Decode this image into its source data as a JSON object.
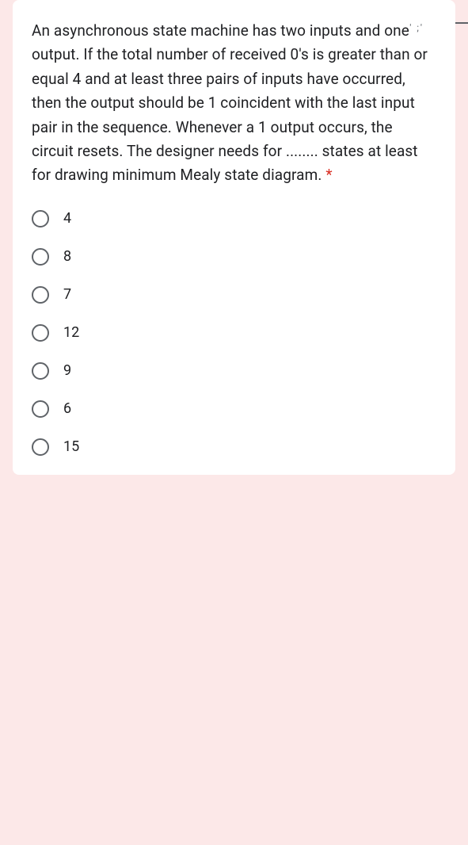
{
  "question": {
    "text": "An asynchronous state machine has two inputs and one output. If the total number of received 0's is greater than or equal 4 and at least three pairs of inputs have occurred, then the output should be 1 coincident with the last input pair in the sequence. Whenever a 1 output occurs, the circuit resets. The designer needs for ........ states at least for drawing minimum Mealy state diagram.",
    "required_marker": "*"
  },
  "options": [
    {
      "label": "4"
    },
    {
      "label": "8"
    },
    {
      "label": "7"
    },
    {
      "label": "12"
    },
    {
      "label": "9"
    },
    {
      "label": "6"
    },
    {
      "label": "15"
    }
  ],
  "decoration": {
    "marks": "' ;'"
  }
}
